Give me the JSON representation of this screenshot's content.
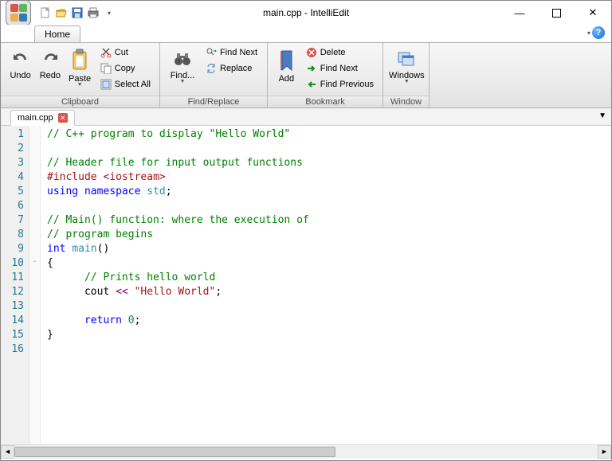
{
  "window": {
    "title": "main.cpp - IntelliEdit"
  },
  "qat": {
    "items": [
      "new",
      "open",
      "save",
      "print",
      "customize"
    ]
  },
  "tabs": {
    "home": "Home"
  },
  "ribbon": {
    "clipboard": {
      "label": "Clipboard",
      "undo": "Undo",
      "redo": "Redo",
      "paste": "Paste",
      "cut": "Cut",
      "copy": "Copy",
      "selectAll": "Select All"
    },
    "findreplace": {
      "label": "Find/Replace",
      "find": "Find...",
      "findNext": "Find Next",
      "replace": "Replace"
    },
    "bookmark": {
      "label": "Bookmark",
      "add": "Add",
      "delete": "Delete",
      "findNext": "Find Next",
      "findPrev": "Find Previous"
    },
    "window": {
      "label": "Window",
      "windows": "Windows"
    }
  },
  "document": {
    "tabName": "main.cpp"
  },
  "code": {
    "lines": [
      {
        "n": 1,
        "fold": "",
        "html": "<span class='c-comment'>// C++ program to display \"Hello World\"</span>"
      },
      {
        "n": 2,
        "fold": "",
        "html": ""
      },
      {
        "n": 3,
        "fold": "",
        "html": "<span class='c-comment'>// Header file for input output functions</span>"
      },
      {
        "n": 4,
        "fold": "",
        "html": "<span class='c-pre'>#include</span> <span class='c-pre'>&lt;iostream&gt;</span>"
      },
      {
        "n": 5,
        "fold": "",
        "html": "<span class='c-kw'>using</span> <span class='c-kw'>namespace</span> <span class='c-type'>std</span>;"
      },
      {
        "n": 6,
        "fold": "",
        "html": ""
      },
      {
        "n": 7,
        "fold": "",
        "html": "<span class='c-comment'>// Main() function: where the execution of</span>"
      },
      {
        "n": 8,
        "fold": "",
        "html": "<span class='c-comment'>// program begins</span>"
      },
      {
        "n": 9,
        "fold": "",
        "html": "<span class='c-kw'>int</span> <span class='c-type'>main</span>()"
      },
      {
        "n": 10,
        "fold": "-",
        "html": "{"
      },
      {
        "n": 11,
        "fold": "",
        "html": "      <span class='c-comment'>// Prints hello world</span>"
      },
      {
        "n": 12,
        "fold": "",
        "html": "      cout <span class='c-op'>&lt;&lt;</span> <span class='c-str'>\"Hello World\"</span>;"
      },
      {
        "n": 13,
        "fold": "",
        "html": ""
      },
      {
        "n": 14,
        "fold": "",
        "html": "      <span class='c-kw'>return</span> <span class='c-num'>0</span>;"
      },
      {
        "n": 15,
        "fold": "",
        "html": "}"
      },
      {
        "n": 16,
        "fold": "",
        "html": ""
      }
    ]
  }
}
